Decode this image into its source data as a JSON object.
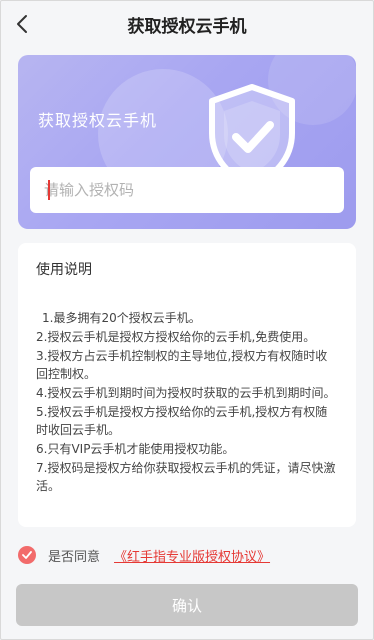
{
  "header": {
    "title": "获取授权云手机"
  },
  "hero": {
    "title": "获取授权云手机",
    "input_placeholder": "请输入授权码",
    "input_value": ""
  },
  "instructions": {
    "title": "使用说明",
    "rules": [
      "1.最多拥有20个授权云手机。",
      "2.授权云手机是授权方授权给你的云手机,免费使用。",
      "3.授权方占云手机控制权的主导地位,授权方有权随时收回控制权。",
      "4.授权云手机到期时间为授权时获取的云手机到期时间。",
      "5.授权云手机是授权方授权给你的云手机,授权方有权随时收回云手机。",
      "6.只有VIP云手机才能使用授权功能。",
      "7.授权码是授权方给你获取授权云手机的凭证，请尽快激活。"
    ]
  },
  "agreement": {
    "checked": true,
    "label": "是否同意",
    "link_text": "《红手指专业版授权协议》"
  },
  "confirm_button": {
    "label": "确认",
    "enabled": false
  },
  "colors": {
    "accent": "#e53935",
    "hero_gradient_start": "#b7b5f1",
    "hero_gradient_end": "#9d9bee",
    "button_disabled": "#c7c7c7"
  }
}
